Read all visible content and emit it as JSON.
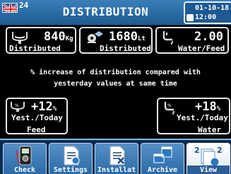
{
  "header": {
    "page_number": "24",
    "title": "DISTRIBUTION",
    "date": "01-10-18",
    "time": "12:00"
  },
  "tiles": {
    "feed": {
      "value": "840",
      "unit": "Kg",
      "caption": "Distributed",
      "icon": "feed-hopper-icon"
    },
    "water": {
      "value": "1680",
      "unit": "Lt",
      "caption": "Distributed",
      "icon": "water-drinker-icon"
    },
    "ratio": {
      "value": "2.00",
      "caption": "Water/Feed",
      "icon": "water-tap-icon"
    }
  },
  "message": {
    "line1": "% increase of distribution compared with",
    "line2": "yesterday values at same time"
  },
  "increase": {
    "feed": {
      "value": "+12",
      "unit": "%",
      "caption": "Yest./Today",
      "sub": "Feed",
      "icon": "feed-percent-icon"
    },
    "water": {
      "value": "+18",
      "unit": "%",
      "caption": "Yest./Today",
      "sub": "Water",
      "icon": "water-percent-icon"
    }
  },
  "toolbar": {
    "buttons": [
      {
        "label": "Check",
        "icon": "multimeter-icon"
      },
      {
        "label": "Settings",
        "icon": "settings-document-icon"
      },
      {
        "label": "Installat",
        "icon": "installation-document-icon"
      },
      {
        "label": "Archive",
        "icon": "archive-windows-icon"
      },
      {
        "label": "View",
        "icon": "view-pages-icon",
        "badges": [
          "2",
          "2"
        ]
      }
    ]
  },
  "colors": {
    "header_blue": "#2a6da8",
    "toolbar_blue": "#3b7dbb",
    "background": "#000000"
  }
}
